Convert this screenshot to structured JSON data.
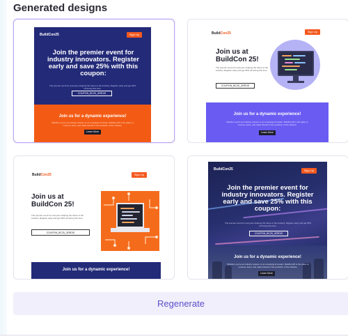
{
  "panel": {
    "title": "Generated designs"
  },
  "designs": [
    {
      "logo": "BuildCon25",
      "signup": "Sign Up",
      "headline": "Join the premier event for industry innovators. Register early and save 25% with this coupon:",
      "body": "The premier event for everyone shaping the future of the industry. Register early and get 25% off during this time.",
      "coupon": "COUPON_BC25_JERDIS",
      "band_title": "Join us for a dynamic experience!",
      "band_text": "Whether you're an industry veteran or an emerging innovator, BuildCon25 is the place to connect, learn, and make friends in the evolution of the industry.",
      "learn_more": "Learn More",
      "colors": {
        "background": "#232a78",
        "band": "#f35b14",
        "accent": "#f4591f"
      },
      "selected": true
    },
    {
      "logo_prefix": "Build",
      "logo_suffix": "Con25",
      "signup": "Sign Up",
      "headline": "Join us at BuildCon 25!",
      "body": "The premier event for everyone shaping the future of the industry. Register early and get 25% off during this time.",
      "coupon": "COUPON_BC25_JERDIS",
      "band_title": "Join us for a dynamic experience!",
      "band_text": "Whether you're an industry veteran or an emerging innovator, BuildCon25 is the place to connect, learn, and make friends in the evolution of the industry.",
      "learn_more": "Learn More",
      "illustration": "monitor-code-icon",
      "colors": {
        "background": "#ffffff",
        "band": "#6a5cf2",
        "accent": "#f4591f"
      },
      "selected": false
    },
    {
      "logo_prefix": "Build",
      "logo_suffix": "Con25",
      "signup": "Sign Up",
      "headline": "Join us at BuildCon 25!",
      "body": "The premier event for everyone shaping the future of the industry. Register early and get 25% off during this time.",
      "coupon": "COUPON_BC25_JERDIS",
      "band_title": "Join us for a dynamic experience!",
      "illustration": "laptop-circuit-icon",
      "colors": {
        "background": "#ffffff",
        "band": "#232a78",
        "accent": "#f56b1c"
      },
      "selected": false
    },
    {
      "logo": "BuildCon25",
      "signup": "Sign Up",
      "headline": "Join the premier event for industry innovators. Register early and save 25% with this coupon:",
      "body": "The premier event for everyone shaping the future of the industry. Register early and get 25% off during this time.",
      "coupon": "COUPON_BC25_JERDIS",
      "band_title": "Join us for a dynamic experience!",
      "band_text": "Whether you're an industry veteran or an emerging innovator, BuildCon25 is the place to connect, learn, and make friends in the evolution of the industry.",
      "learn_more": "Learn More",
      "colors": {
        "background": "#27306e",
        "band": "#2f3a78",
        "accent": "#f4591f"
      },
      "selected": false
    }
  ],
  "actions": {
    "regenerate": "Regenerate"
  },
  "colors": {
    "selected_border": "#b9a7f0",
    "regenerate_bg": "#f1effc",
    "regenerate_text": "#5a4fc8"
  }
}
